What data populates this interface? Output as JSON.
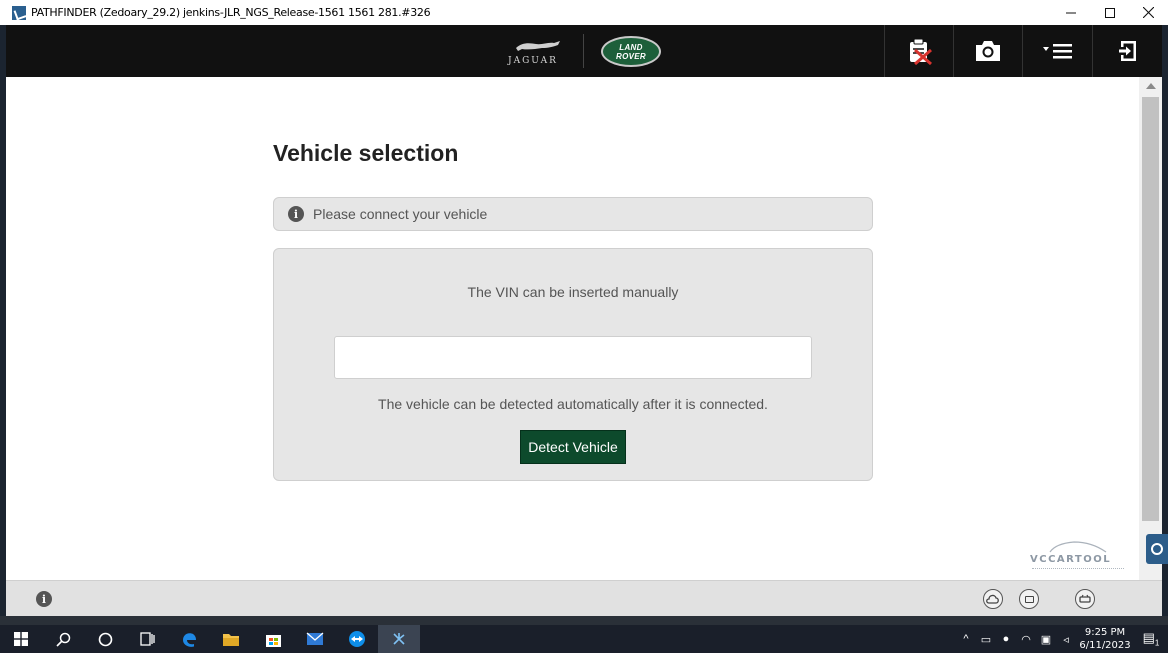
{
  "window": {
    "title": "PATHFINDER (Zedoary_29.2) jenkins-JLR_NGS_Release-1561 1561 281.#326",
    "controls": [
      "minimize",
      "maximize",
      "close"
    ]
  },
  "header": {
    "logos": {
      "jaguar": "JAGUAR",
      "land_rover_line1": "LAND",
      "land_rover_line2": "ROVER"
    },
    "buttons": [
      "clipboard-disabled-icon",
      "camera-icon",
      "menu-icon",
      "exit-icon"
    ]
  },
  "main": {
    "title": "Vehicle selection",
    "info_message": "Please connect your vehicle",
    "vin_hint": "The VIN can be inserted manually",
    "vin_value": "",
    "detect_hint": "The vehicle can be detected automatically after it is connected.",
    "detect_button": "Detect Vehicle"
  },
  "watermark": "VCCARTOOL",
  "footer": {
    "icons": [
      "info-icon",
      "cloud-status-icon",
      "vci-status-icon",
      "car-status-icon"
    ]
  },
  "taskbar": {
    "time": "9:25 PM",
    "date": "6/11/2023",
    "notification_count": "1"
  },
  "colors": {
    "header_bg": "#111111",
    "detect_button_bg": "#0d4a2c",
    "panel_bg": "#e6e6e6",
    "land_rover_green": "#1d5f3a"
  }
}
